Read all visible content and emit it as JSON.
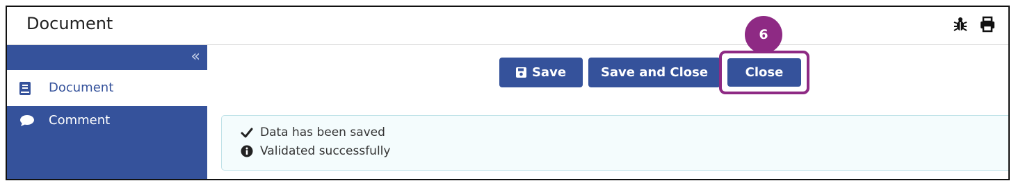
{
  "header": {
    "title": "Document",
    "icons": [
      "bug-icon",
      "print-icon"
    ]
  },
  "sidebar": {
    "collapse_glyph": "«",
    "items": [
      {
        "label": "Document",
        "icon": "book-icon",
        "active": true
      },
      {
        "label": "Comment",
        "icon": "comment-icon",
        "active": false
      }
    ]
  },
  "toolbar": {
    "save_label": "Save",
    "save_close_label": "Save and Close",
    "close_label": "Close"
  },
  "annotation": {
    "step_number": "6",
    "color": "#8e2a84"
  },
  "alert": {
    "lines": [
      {
        "text": "Data has been saved",
        "icon": "check-icon"
      },
      {
        "text": "Validated successfully",
        "icon": "info-icon"
      }
    ]
  },
  "colors": {
    "primary": "#35529b",
    "alert_bg": "#f4fcfd",
    "alert_border": "#bfe2e8",
    "annotation": "#8e2a84"
  }
}
